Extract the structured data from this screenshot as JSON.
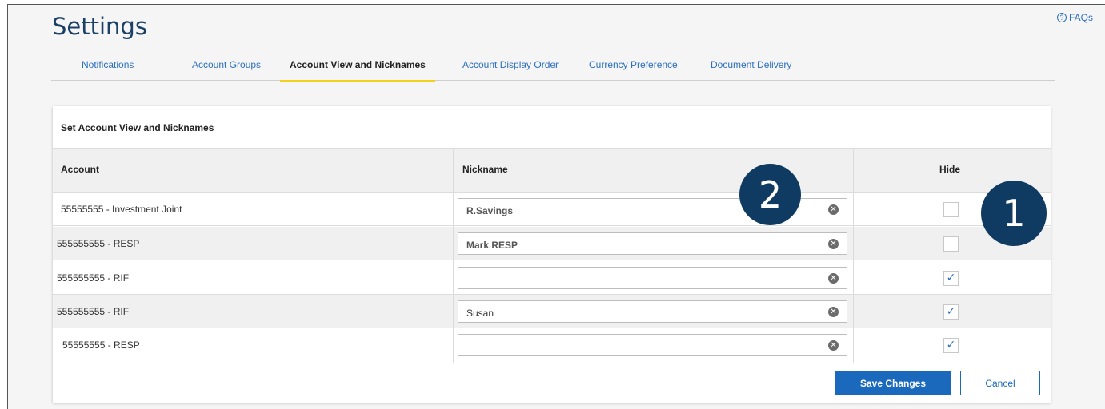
{
  "page": {
    "title": "Settings",
    "faq_label": "FAQs",
    "faq_icon": "question-circle-icon"
  },
  "tabs": [
    {
      "label": "Notifications"
    },
    {
      "label": "Account Groups"
    },
    {
      "label": "Account View and Nicknames",
      "active": true
    },
    {
      "label": "Account Display Order"
    },
    {
      "label": "Currency Preference"
    },
    {
      "label": "Document Delivery"
    }
  ],
  "card": {
    "title": "Set Account View and Nicknames",
    "columns": {
      "account": "Account",
      "nickname": "Nickname",
      "hide": "Hide"
    },
    "rows": [
      {
        "account": "55555555 - Investment Joint",
        "nickname": "R.Savings",
        "hidden": false
      },
      {
        "account": "555555555 - RESP",
        "nickname": "Mark RESP",
        "hidden": false
      },
      {
        "account": "555555555 - RIF",
        "nickname": "",
        "hidden": true
      },
      {
        "account": "555555555 - RIF",
        "nickname": "Susan",
        "hidden": true
      },
      {
        "account": "55555555 - RESP",
        "nickname": "",
        "hidden": true
      }
    ],
    "save_label": "Save Changes",
    "cancel_label": "Cancel"
  },
  "callouts": {
    "one": "1",
    "two": "2"
  },
  "colors": {
    "brand_navy": "#1c3f66",
    "link_blue": "#2c6fbf",
    "button_blue": "#1a69bd",
    "tab_highlight": "#f2d11b",
    "callout": "#0f3b63"
  }
}
